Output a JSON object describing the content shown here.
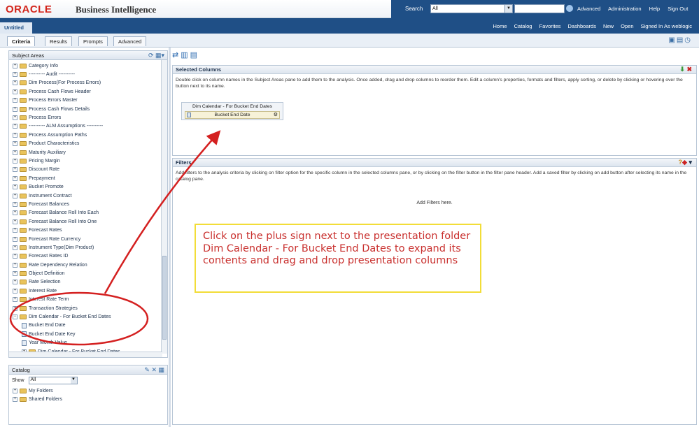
{
  "header": {
    "logo": "ORACLE",
    "product": "Business Intelligence",
    "search_label": "Search",
    "search_scope": "All",
    "links": [
      "Advanced",
      "Administration",
      "Help",
      "Sign Out"
    ]
  },
  "navbar": {
    "tab_name": "Untitled",
    "links": [
      "Home",
      "Catalog",
      "Favorites",
      "Dashboards",
      "New",
      "Open",
      "Signed In As weblogic"
    ]
  },
  "tabs": [
    "Criteria",
    "Results",
    "Prompts",
    "Advanced"
  ],
  "subject_areas": {
    "title": "Subject Areas",
    "items": [
      {
        "label": "Category Info",
        "kind": "folder"
      },
      {
        "label": "---------- Audit ----------",
        "kind": "folder"
      },
      {
        "label": "Dim Process(For Process Errors)",
        "kind": "folder"
      },
      {
        "label": "Process Cash Flows Header",
        "kind": "folder"
      },
      {
        "label": "Process Errors Master",
        "kind": "folder"
      },
      {
        "label": "Process Cash Flows Details",
        "kind": "folder"
      },
      {
        "label": "Process Errors",
        "kind": "folder"
      },
      {
        "label": "---------- ALM Assumptions ----------",
        "kind": "folder"
      },
      {
        "label": "Process Assumption Paths",
        "kind": "folder"
      },
      {
        "label": "Product Characteristics",
        "kind": "folder"
      },
      {
        "label": "Maturity Auxiliary",
        "kind": "folder"
      },
      {
        "label": "Pricing Margin",
        "kind": "folder"
      },
      {
        "label": "Discount Rate",
        "kind": "folder"
      },
      {
        "label": "Prepayment",
        "kind": "folder"
      },
      {
        "label": "Bucket Promote",
        "kind": "folder"
      },
      {
        "label": "Instrument Contract",
        "kind": "folder"
      },
      {
        "label": "Forecast Balances",
        "kind": "folder"
      },
      {
        "label": "Forecast Balance Roll Into Each",
        "kind": "folder"
      },
      {
        "label": "Forecast Balance Roll Into One",
        "kind": "folder"
      },
      {
        "label": "Forecast Rates",
        "kind": "folder"
      },
      {
        "label": "Forecast Rate Currency",
        "kind": "folder"
      },
      {
        "label": "Instrument Type(Dim Product)",
        "kind": "folder"
      },
      {
        "label": "Forecast Rates ID",
        "kind": "folder"
      },
      {
        "label": "Rate Dependency Relation",
        "kind": "folder"
      },
      {
        "label": "Object Definition",
        "kind": "folder"
      },
      {
        "label": "Rate Selection",
        "kind": "folder"
      },
      {
        "label": "Interest Rate",
        "kind": "folder"
      },
      {
        "label": "Interest Rate Term",
        "kind": "folder"
      },
      {
        "label": "Transaction Strategies",
        "kind": "folder"
      },
      {
        "label": "Dim Calendar - For Bucket End Dates",
        "kind": "expanded"
      },
      {
        "label": "Bucket End Date",
        "kind": "column"
      },
      {
        "label": "Bucket End Date Key",
        "kind": "column"
      },
      {
        "label": "Year Month Value",
        "kind": "column"
      },
      {
        "label": "Dim Calendar - For Bucket End Dates",
        "kind": "folder2"
      }
    ]
  },
  "catalog": {
    "title": "Catalog",
    "show_label": "Show",
    "show_value": "All",
    "items": [
      "My Folders",
      "Shared Folders"
    ]
  },
  "selected_columns": {
    "title": "Selected Columns",
    "text": "Double click on column names in the Subject Areas pane to add them to the analysis. Once added, drag and drop columns to reorder them. Edit a column's properties, formats and filters, apply sorting, or delete by clicking or hovering over the button next to its name.",
    "folder_caption": "Dim Calendar - For Bucket End Dates",
    "column": "Bucket End Date"
  },
  "filters": {
    "title": "Filters",
    "text": "Add filters to the analysis criteria by clicking on filter option for the specific column in the selected columns pane, or by clicking on the filter button in the filter pane header. Add a saved filter by clicking on add button after selecting its name in the catalog pane.",
    "empty": "Add Filters here."
  },
  "callout": {
    "text": "Click on the plus sign next to the presentation folder Dim Calendar - For Bucket End Dates to expand its contents and drag and drop presentation columns"
  },
  "colors": {
    "brand_red": "#d3251b",
    "nav_blue": "#1f4f86",
    "callout_border": "#f2dd38",
    "annotation_red": "#d42020"
  }
}
